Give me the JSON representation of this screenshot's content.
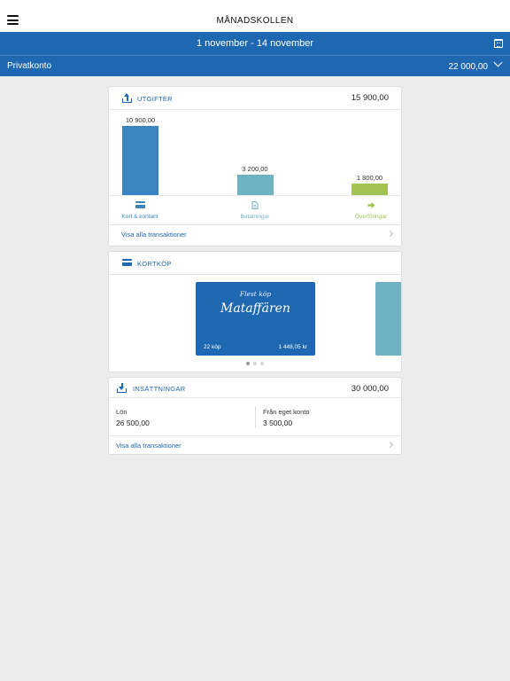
{
  "header": {
    "title": "MÅNADSKOLLEN",
    "menu_icon": "hamburger-menu-icon"
  },
  "period": {
    "label": "1 november - 14 november",
    "icon": "calendar-icon"
  },
  "account": {
    "name": "Privatkonto",
    "balance": "22 000,00",
    "icon": "chevron-down-icon"
  },
  "colors": {
    "primary": "#1e67b1",
    "teal": "#6fb2c1",
    "green": "#a4c355",
    "background": "#ececec"
  },
  "expenses": {
    "title": "UTGIFTER",
    "total": "15 900,00",
    "link": "Visa alla transaktioner",
    "categories": [
      {
        "label": "Kort & kontant",
        "value": 10900,
        "value_label": "10 900,00",
        "icon": "card-icon",
        "color": "#3a85c0"
      },
      {
        "label": "Betalningar",
        "value": 3200,
        "value_label": "3 200,00",
        "icon": "document-icon",
        "color": "#6fb2c1"
      },
      {
        "label": "Överföringar",
        "value": 1800,
        "value_label": "1 800,00",
        "icon": "arrow-right-icon",
        "color": "#a4c355"
      }
    ]
  },
  "card_purchases": {
    "title": "KORTKÖP",
    "slide": {
      "subtitle": "Flest köp",
      "name": "Mataffären",
      "count": "22 köp",
      "amount": "1 448,05 kr"
    },
    "page_indicator": {
      "current": 1,
      "total": 3
    }
  },
  "deposits": {
    "title": "INSÄTTNINGAR",
    "total": "30 000,00",
    "items": [
      {
        "label": "Lön",
        "amount": "26 500,00"
      },
      {
        "label": "Från eget konto",
        "amount": "3 500,00"
      }
    ],
    "link": "Visa alla transaktioner"
  }
}
